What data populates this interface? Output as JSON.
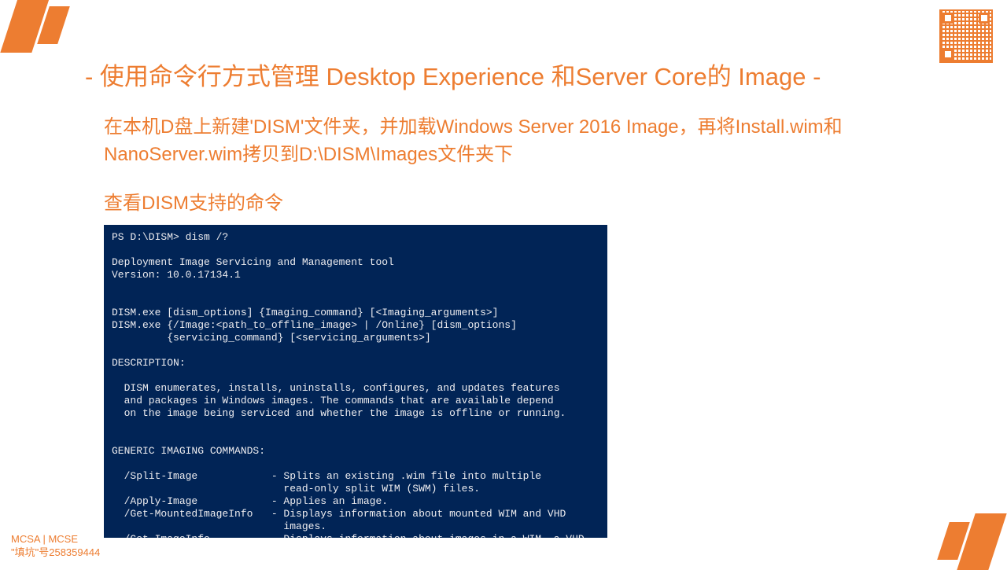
{
  "title": "- 使用命令行方式管理 Desktop Experience 和Server Core的 Image -",
  "subtitle": "在本机D盘上新建'DISM'文件夹，并加载Windows Server 2016 Image，再将Install.wim和NanoServer.wim拷贝到D:\\DISM\\Images文件夹下",
  "sectionTitle": "查看DISM支持的命令",
  "terminal": "PS D:\\DISM> dism /?\n\nDeployment Image Servicing and Management tool\nVersion: 10.0.17134.1\n\n\nDISM.exe [dism_options] {Imaging_command} [<Imaging_arguments>]\nDISM.exe {/Image:<path_to_offline_image> | /Online} [dism_options]\n         {servicing_command} [<servicing_arguments>]\n\nDESCRIPTION:\n\n  DISM enumerates, installs, uninstalls, configures, and updates features\n  and packages in Windows images. The commands that are available depend\n  on the image being serviced and whether the image is offline or running.\n\n\nGENERIC IMAGING COMMANDS:\n\n  /Split-Image            - Splits an existing .wim file into multiple\n                            read-only split WIM (SWM) files.\n  /Apply-Image            - Applies an image.\n  /Get-MountedImageInfo   - Displays information about mounted WIM and VHD\n                            images.\n  /Get-ImageInfo          - Displays information about images in a WIM, a VHD",
  "footer": {
    "line1": "MCSA | MCSE",
    "line2": "\"填坑\"号258359444"
  }
}
